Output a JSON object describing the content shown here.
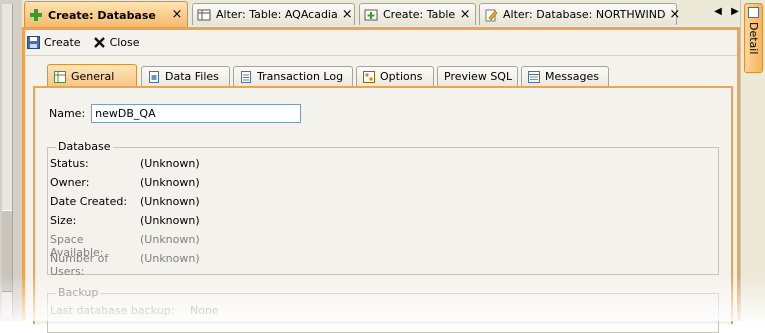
{
  "tabs": [
    {
      "label": "Create: Database",
      "icon": "create-database-icon",
      "active": true
    },
    {
      "label": "Alter: Table: AQAcadia",
      "icon": "table-icon",
      "active": false
    },
    {
      "label": "Create: Table",
      "icon": "create-table-icon",
      "active": false
    },
    {
      "label": "Alter: Database: NORTHWIND",
      "icon": "edit-database-icon",
      "active": false
    }
  ],
  "nav": {
    "prev": "◀",
    "next": "▶",
    "list": "☰"
  },
  "toolbar": {
    "create_label": "Create",
    "close_label": "Close"
  },
  "inner_tabs": [
    {
      "label": "General",
      "icon": "general-icon",
      "active": true
    },
    {
      "label": "Data Files",
      "icon": "data-files-icon"
    },
    {
      "label": "Transaction Log",
      "icon": "transaction-log-icon"
    },
    {
      "label": "Options",
      "icon": "options-icon"
    },
    {
      "label": "Preview SQL",
      "icon": ""
    },
    {
      "label": "Messages",
      "icon": "messages-icon"
    }
  ],
  "name": {
    "label": "Name:",
    "value": "newDB_QA"
  },
  "database": {
    "title": "Database",
    "rows": [
      {
        "label": "Status:",
        "value": "(Unknown)"
      },
      {
        "label": "Owner:",
        "value": "(Unknown)"
      },
      {
        "label": "Date Created:",
        "value": "(Unknown)"
      },
      {
        "label": "Size:",
        "value": "(Unknown)"
      },
      {
        "label": "Space Available:",
        "value": "(Unknown)"
      },
      {
        "label": "Number of Users:",
        "value": "(Unknown)"
      }
    ]
  },
  "backup": {
    "title": "Backup",
    "rows": [
      {
        "label": "Last database backup:",
        "value": "None"
      }
    ]
  },
  "detail_tab": {
    "label": "Detail"
  },
  "colors": {
    "accent": "#f0a34d",
    "active_tab": "#f6b96a",
    "panel_bg": "#f4f2ec",
    "chrome": "#ece9d8"
  }
}
